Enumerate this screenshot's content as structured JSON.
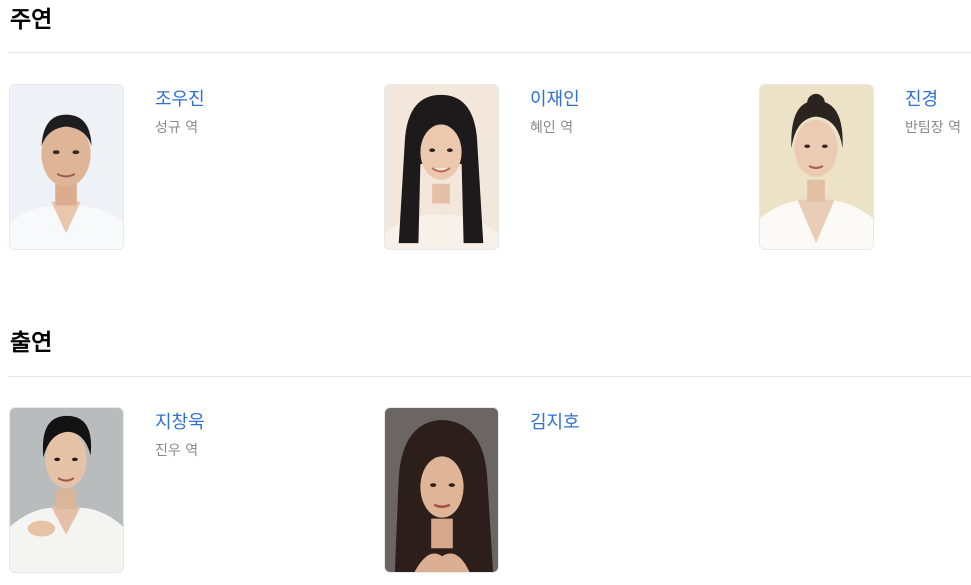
{
  "main_cast": {
    "title": "주연",
    "members": [
      {
        "name": "조우진",
        "role": "성규 역"
      },
      {
        "name": "이재인",
        "role": "혜인 역"
      },
      {
        "name": "진경",
        "role": "반팀장 역"
      }
    ]
  },
  "supporting_cast": {
    "title": "출연",
    "members": [
      {
        "name": "지창욱",
        "role": "진우 역"
      },
      {
        "name": "김지호",
        "role": ""
      }
    ]
  },
  "colors": {
    "name_link": "#2f6fd6",
    "role_text": "#8a8a8a",
    "divider": "#e6e6e6"
  }
}
